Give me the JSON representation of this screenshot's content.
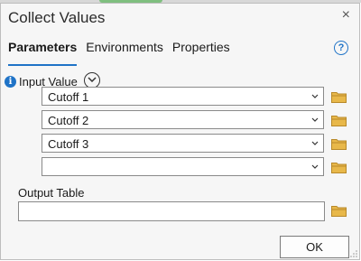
{
  "window": {
    "title": "Collect Values"
  },
  "tabs": [
    {
      "label": "Parameters",
      "active": true
    },
    {
      "label": "Environments",
      "active": false
    },
    {
      "label": "Properties",
      "active": false
    }
  ],
  "help_glyph": "?",
  "info_glyph": "i",
  "input_value": {
    "label": "Input Value",
    "rows": [
      {
        "value": "Cutoff 1"
      },
      {
        "value": "Cutoff 2"
      },
      {
        "value": "Cutoff 3"
      },
      {
        "value": ""
      }
    ]
  },
  "output_table": {
    "label": "Output Table",
    "value": ""
  },
  "ok_label": "OK",
  "close_glyph": "×",
  "colors": {
    "accent": "#1f73c7",
    "folder": "#e8b84a"
  },
  "icons": [
    "close-icon",
    "help-icon",
    "info-icon",
    "expand-icon",
    "chevron-down-icon",
    "folder-icon",
    "resize-grip-icon"
  ]
}
